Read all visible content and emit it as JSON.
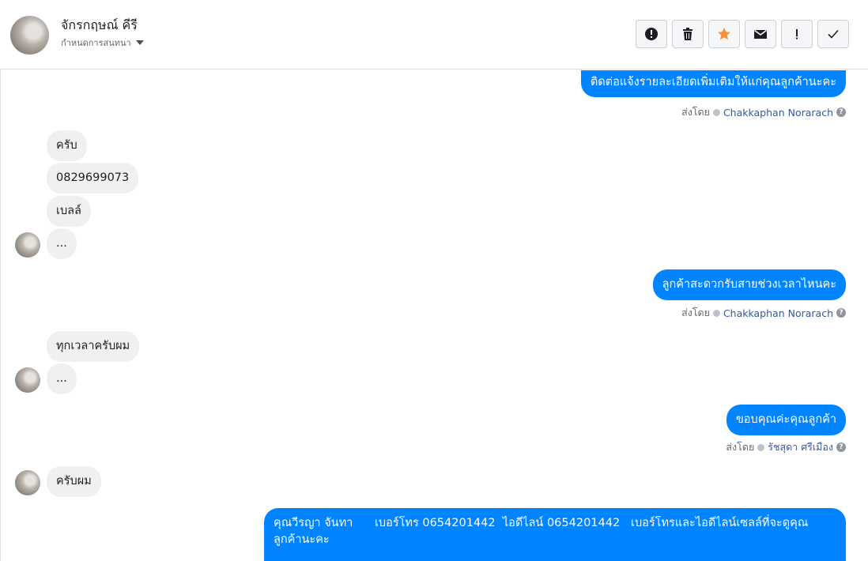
{
  "header": {
    "name": "จักรกฤษณ์ คีรี",
    "subtitle": "กำหนดการสนทนา"
  },
  "toolbar": {
    "buttons": [
      {
        "icon": "alert-circle-icon"
      },
      {
        "icon": "trash-icon"
      },
      {
        "icon": "star-icon",
        "color": "#f7923a"
      },
      {
        "icon": "envelope-icon"
      },
      {
        "icon": "exclamation-icon"
      },
      {
        "icon": "check-icon"
      }
    ]
  },
  "messages": [
    {
      "side": "out",
      "lines": [
        "ติดต่อแจ้งรายละเอียดเพิ่มเติมให้แก่คุณลูกค้านะคะ"
      ],
      "sent_by_label": "ส่งโดย",
      "sent_by": "Chakkaphan Norarach"
    },
    {
      "side": "in",
      "text": "ครับ"
    },
    {
      "side": "in",
      "text": "0829699073"
    },
    {
      "side": "in",
      "text": "เบลล์"
    },
    {
      "side": "in",
      "text": "..."
    },
    {
      "side": "out",
      "text": "ลูกค้าสะดวกรับสายช่วงเวลาไหนคะ",
      "sent_by_label": "ส่งโดย",
      "sent_by": "Chakkaphan Norarach"
    },
    {
      "side": "in",
      "text": "ทุกเวลาครับผม"
    },
    {
      "side": "in",
      "text": "..."
    },
    {
      "side": "out",
      "text": "ขอบคุณค่ะคุณลูกค้า",
      "sent_by_label": "ส่งโดย",
      "sent_by": "รัชสุดา ศรีเมือง"
    },
    {
      "side": "in",
      "text": "ครับผม"
    },
    {
      "side": "out",
      "lines": [
        "คุณวีรญา จันทา      เบอร์โทร 0654201442  ไอดีไลน์ 0654201442   เบอร์โทรและไอดีไลน์เซลล์ที่จะดูคุณ",
        "ลูกค้านะคะ"
      ]
    }
  ],
  "colors": {
    "accent": "#0084ff",
    "incoming": "#f0f0f0"
  }
}
